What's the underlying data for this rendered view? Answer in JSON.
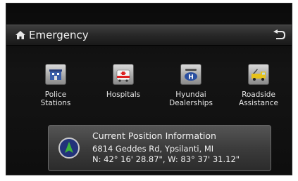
{
  "header": {
    "title": "Emergency",
    "home_icon": "home-icon",
    "back_icon": "back-arrow-icon"
  },
  "items": [
    {
      "label": "Police\nStations",
      "icon": "police-station-icon"
    },
    {
      "label": "Hospitals",
      "icon": "hospital-icon"
    },
    {
      "label": "Hyundai\nDealerships",
      "icon": "hyundai-dealership-icon"
    },
    {
      "label": "Roadside\nAssistance",
      "icon": "tow-truck-icon"
    }
  ],
  "position_info": {
    "title": "Current Position Information",
    "address": "6814 Geddes Rd, Ypsilanti, MI",
    "coordinates": "N: 42° 16' 28.87\", W: 83° 37' 31.12\"",
    "icon": "compass-arrow-icon"
  },
  "colors": {
    "accent_green": "#3cb43c",
    "background": "#111111",
    "text": "#f0f0f0"
  }
}
